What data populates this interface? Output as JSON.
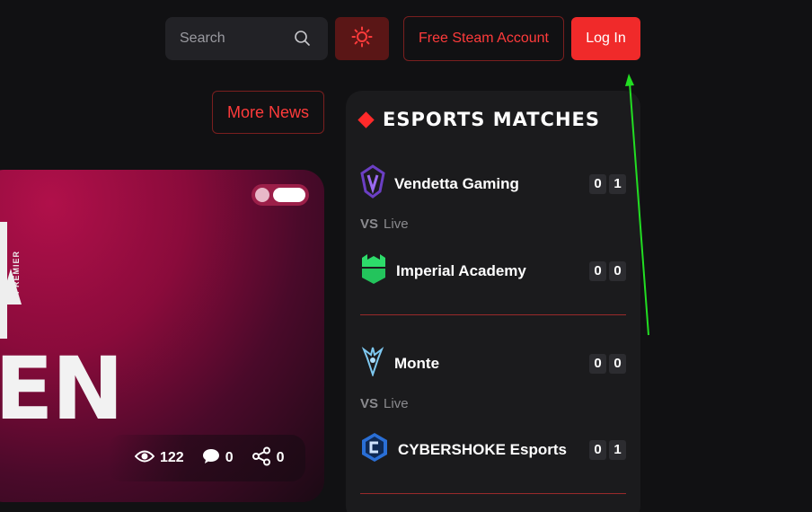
{
  "header": {
    "search_placeholder": "Search",
    "steam_label": "Free Steam Account",
    "login_label": "Log In"
  },
  "news": {
    "more_news_label": "More News",
    "card": {
      "logo_small_text": "PREMIER",
      "logo_big_text": "EN",
      "views": "122",
      "comments": "0",
      "shares": "0"
    }
  },
  "matches": {
    "title": "ESPORTS MATCHES",
    "list": [
      {
        "team1": {
          "name": "Vendetta Gaming",
          "score": [
            "0",
            "1"
          ],
          "icon": "vendetta-logo-icon"
        },
        "vs_label": "VS",
        "status": "Live",
        "team2": {
          "name": "Imperial Academy",
          "score": [
            "0",
            "0"
          ],
          "icon": "imperial-logo-icon"
        }
      },
      {
        "team1": {
          "name": "Monte",
          "score": [
            "0",
            "0"
          ],
          "icon": "monte-logo-icon"
        },
        "vs_label": "VS",
        "status": "Live",
        "team2": {
          "name": "CYBERSHOKE Esports",
          "score": [
            "0",
            "1"
          ],
          "icon": "cybershoke-logo-icon"
        }
      }
    ]
  },
  "colors": {
    "accent": "#f02a2a",
    "background": "#111113",
    "panel": "#1b1b1d",
    "annotation_arrow": "#22dd22"
  }
}
